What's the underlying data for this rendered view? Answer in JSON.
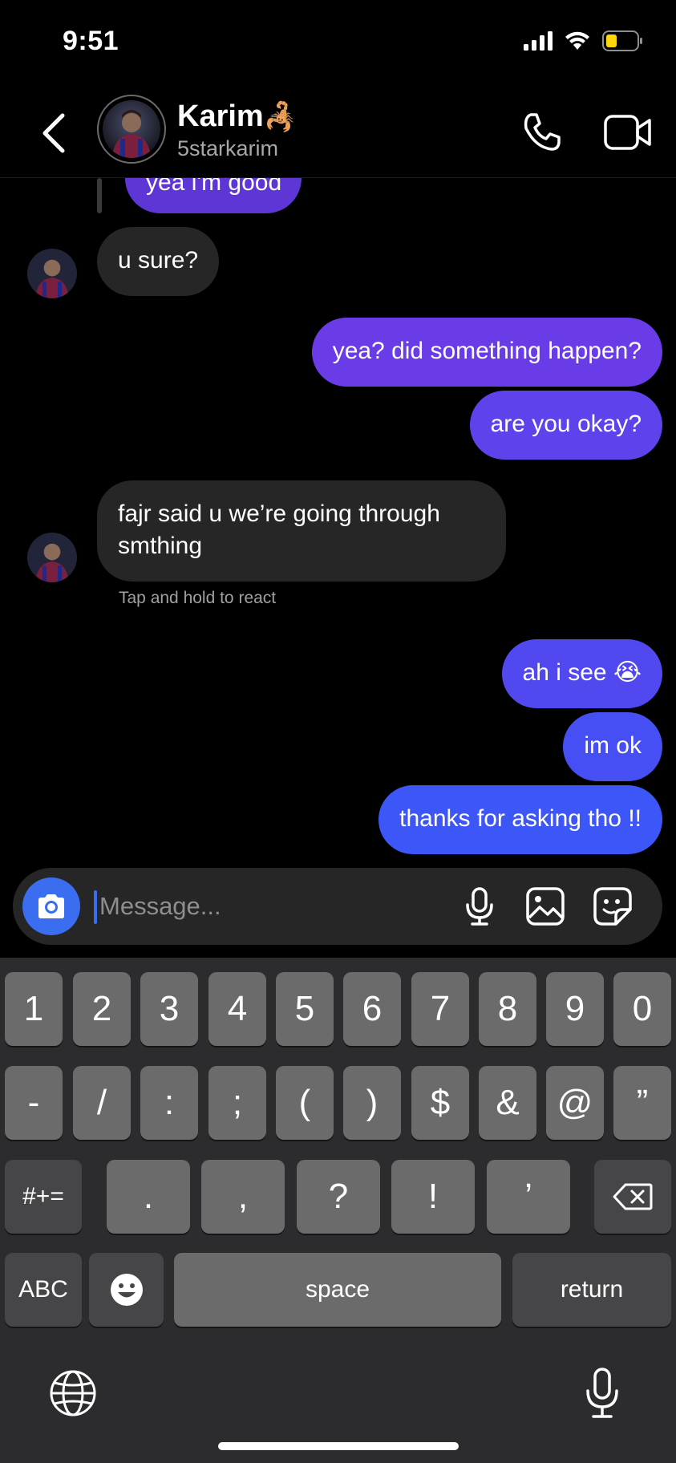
{
  "status_bar": {
    "time": "9:51"
  },
  "header": {
    "contact_name": "Karim",
    "name_emoji": "🦂",
    "username": "5starkarim",
    "icons": [
      "back-chevron-icon",
      "phone-icon",
      "video-camera-icon"
    ]
  },
  "messages": [
    {
      "direction": "outgoing",
      "text": "yea i'm good",
      "partially_visible": true
    },
    {
      "direction": "incoming",
      "text": "u sure?"
    },
    {
      "direction": "outgoing",
      "text": "yea? did something happen?"
    },
    {
      "direction": "outgoing",
      "text": "are you okay?"
    },
    {
      "direction": "incoming",
      "lines": [
        "fajr said u we’re going through",
        "smthing"
      ]
    },
    {
      "direction": "outgoing",
      "text": "ah i see",
      "emoji": "😭"
    },
    {
      "direction": "outgoing",
      "text": "im ok"
    },
    {
      "direction": "outgoing",
      "text": "thanks for asking tho !!"
    }
  ],
  "hint": "Tap and hold to react",
  "composer": {
    "placeholder": "Message...",
    "icons": [
      "camera-icon",
      "microphone-icon",
      "image-icon",
      "sticker-icon"
    ]
  },
  "keyboard": {
    "row1": [
      "1",
      "2",
      "3",
      "4",
      "5",
      "6",
      "7",
      "8",
      "9",
      "0"
    ],
    "row2": [
      "-",
      "/",
      ":",
      ";",
      "(",
      ")",
      "$",
      "&",
      "@",
      "”"
    ],
    "row3": [
      "#+=",
      ".",
      ",",
      "?",
      "!",
      "’"
    ],
    "abc": "ABC",
    "space": "space",
    "return": "return"
  },
  "colors": {
    "bubble_out_top": "#6a38e8",
    "bubble_out_bottom": "#3d5afe",
    "bubble_in": "#262626",
    "accent_blue": "#3a6df0"
  }
}
